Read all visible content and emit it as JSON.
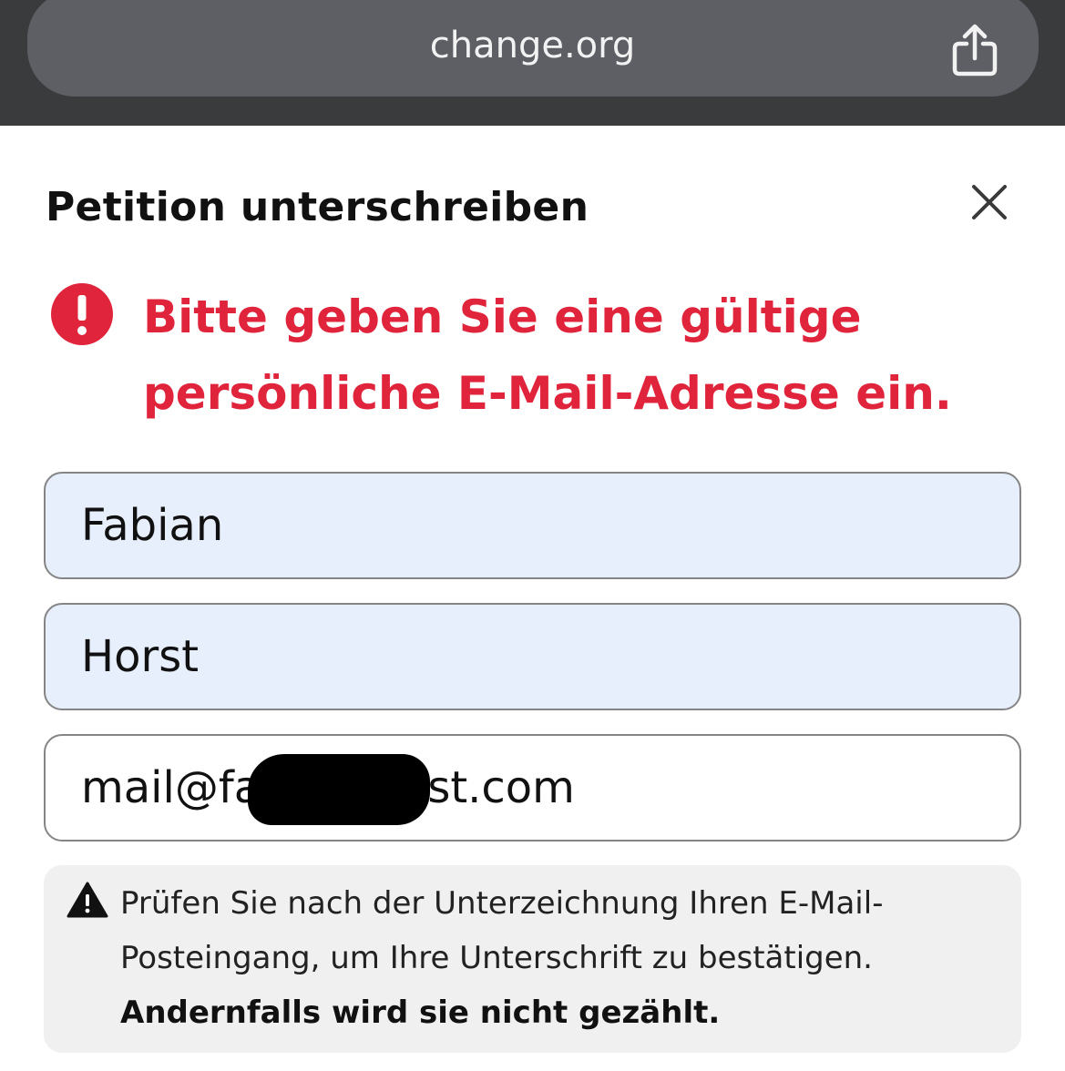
{
  "browser": {
    "url": "change.org",
    "share_icon": "share-icon"
  },
  "dialog": {
    "title": "Petition unterschreiben",
    "close_icon": "close-icon"
  },
  "error": {
    "icon": "exclamation-circle-icon",
    "message": "Bitte geben Sie eine gültige persönliche E-Mail-Adresse ein.",
    "color": "#e0243b"
  },
  "form": {
    "first_name": "Fabian",
    "last_name": "Horst",
    "email": "mail@fabianhorst.com",
    "autofill_bg": "#e8effc"
  },
  "notice": {
    "icon": "warning-icon",
    "text": "Prüfen Sie nach der Unterzeichnung Ihren E-Mail-Posteingang, um Ihre Unterschrift zu bestätigen.",
    "bold_text": "Andernfalls wird sie nicht gezählt."
  }
}
